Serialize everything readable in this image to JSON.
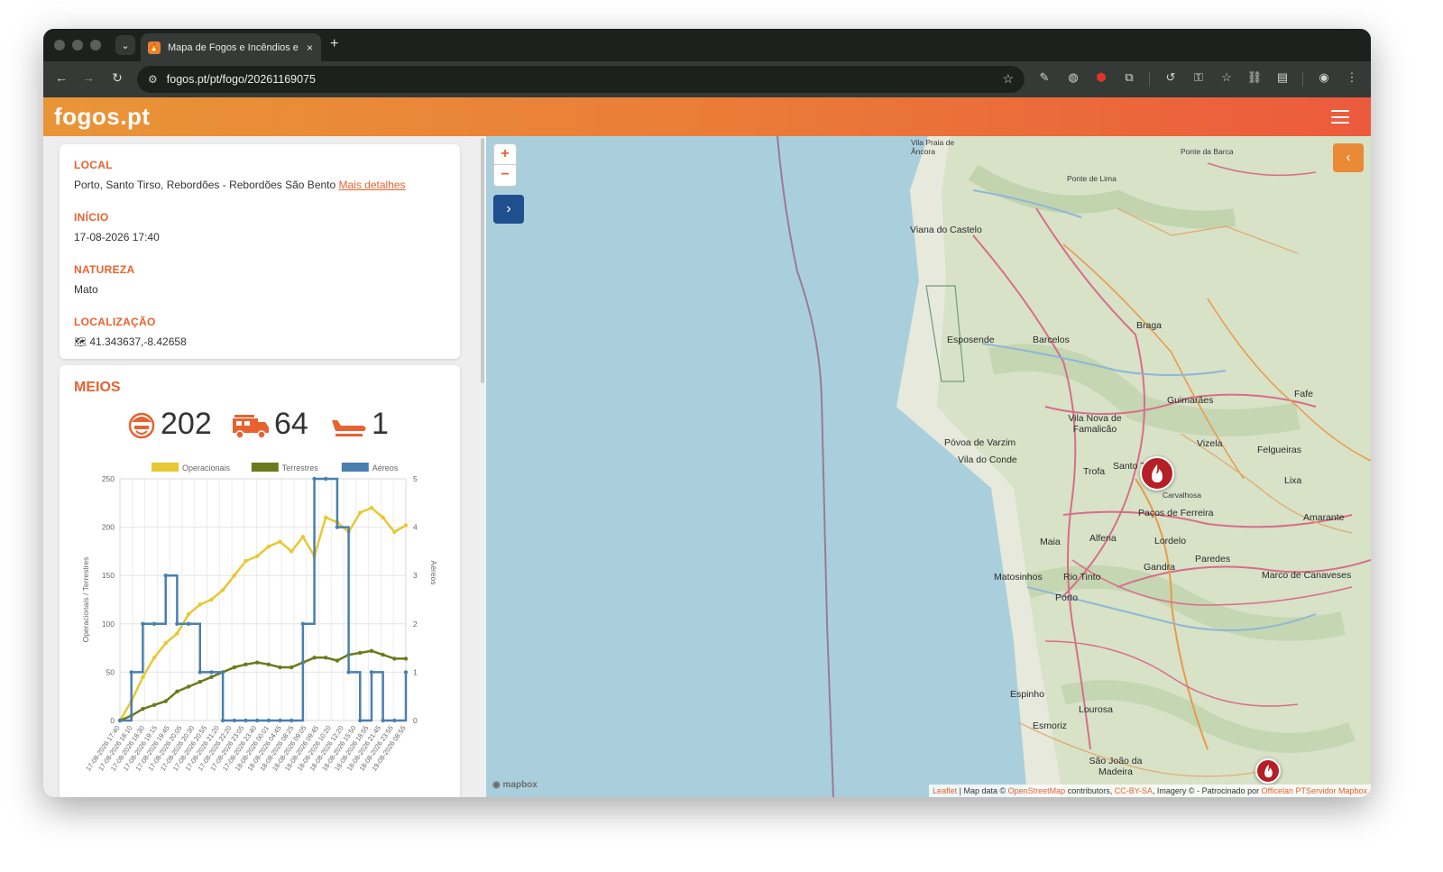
{
  "browser": {
    "tab_title": "Mapa de Fogos e Incêndios e",
    "tab_close": "×",
    "new_tab": "+",
    "url": "fogos.pt/pt/fogo/20261169075"
  },
  "site": {
    "logo": "fogos.pt"
  },
  "details": {
    "local_label": "LOCAL",
    "local_value": "Porto, Santo Tirso, Rebordões - Rebordões São Bento",
    "local_link": "Mais detalhes",
    "inicio_label": "INÍCIO",
    "inicio_value": "17-08-2026 17:40",
    "natureza_label": "NATUREZA",
    "natureza_value": "Mato",
    "localizacao_label": "LOCALIZAÇÃO",
    "localizacao_value": "41.343637,-8.42658"
  },
  "meios": {
    "title": "MEIOS",
    "operacionais": "202",
    "terrestres": "64",
    "aereos": "1"
  },
  "chart_data": {
    "type": "line",
    "legend_position": "top",
    "series": [
      {
        "name": "Operacionais",
        "color": "#e8c832",
        "axis": "left",
        "values": [
          0,
          20,
          45,
          65,
          80,
          90,
          110,
          120,
          125,
          135,
          150,
          165,
          170,
          180,
          185,
          175,
          190,
          170,
          210,
          205,
          195,
          215,
          220,
          210,
          195,
          202
        ]
      },
      {
        "name": "Terrestres",
        "color": "#6b7a1c",
        "axis": "left",
        "values": [
          0,
          5,
          12,
          16,
          20,
          30,
          35,
          40,
          45,
          50,
          55,
          58,
          60,
          58,
          55,
          55,
          60,
          65,
          65,
          62,
          68,
          70,
          72,
          68,
          64,
          64
        ]
      },
      {
        "name": "Aéreos",
        "color": "#4a7fb0",
        "axis": "right",
        "values": [
          0,
          1,
          2,
          2,
          3,
          2,
          2,
          1,
          1,
          0,
          0,
          0,
          0,
          0,
          0,
          0,
          2,
          5,
          5,
          4,
          1,
          0,
          1,
          0,
          0,
          1
        ]
      }
    ],
    "categories": [
      "17-08-2026 17:40",
      "17-08-2026 18:10",
      "17-08-2026 18:30",
      "17-08-2026 19:15",
      "17-08-2026 19:45",
      "17-08-2026 20:05",
      "17-08-2026 20:30",
      "17-08-2026 20:55",
      "17-08-2026 21:20",
      "17-08-2026 22:20",
      "17-08-2026 23:05",
      "17-08-2026 23:40",
      "18-08-2026 00:01",
      "18-08-2026 04:45",
      "18-08-2026 08:25",
      "18-08-2026 09:05",
      "18-08-2026 09:45",
      "18-08-2026 10:20",
      "18-08-2026 12:20",
      "18-08-2026 15:50",
      "18-08-2026 18:55",
      "18-08-2026 21:45",
      "18-08-2026 23:55",
      "19-08-2026 08:55"
    ],
    "ylabel_left": "Operacionais / Terrestres",
    "ylabel_right": "Aéreos",
    "ylim_left": [
      0,
      250
    ],
    "ylim_right": [
      0,
      5
    ],
    "yticks_left": [
      "0",
      "50",
      "100",
      "150",
      "200",
      "250"
    ],
    "yticks_right": [
      "0",
      "1",
      "2",
      "3",
      "4",
      "5"
    ]
  },
  "map": {
    "zoom_in": "+",
    "zoom_out": "−",
    "expand": "›",
    "collapse": "‹",
    "mapbox": "mapbox",
    "attribution_leaflet": "Leaflet",
    "attribution_text1": " | Map data © ",
    "attribution_osm": "OpenStreetMap",
    "attribution_text2": " contributors, ",
    "attribution_cc": "CC-BY-SA",
    "attribution_text3": ", Imagery © - Patrocinado por ",
    "attribution_sponsor": "Officelan PTServidor Mapbox",
    "towns": {
      "viana": "Viana do Castelo",
      "esposende": "Esposende",
      "barcelos": "Barcelos",
      "braga": "Braga",
      "guimaraes": "Guimarães",
      "famalicao": "Vila Nova de Famalicão",
      "povoa": "Póvoa de Varzim",
      "vilaconde": "Vila do Conde",
      "trofa": "Trofa",
      "santotirso": "Santo Tirso",
      "pacos": "Paços de Ferreira",
      "felgueiras": "Felgueiras",
      "vizela": "Vizela",
      "lixa": "Lixa",
      "amarante": "Amarante",
      "maia": "Maia",
      "alfena": "Alfena",
      "lordelo": "Lordelo",
      "paredes": "Paredes",
      "gandra": "Gandra",
      "matosinhos": "Matosinhos",
      "riotinto": "Rio Tinto",
      "porto": "Porto",
      "marco": "Marco de Canaveses",
      "espinho": "Espinho",
      "lourosa": "Lourosa",
      "esmoriz": "Esmoriz",
      "saojoao": "São João da Madeira",
      "fafe": "Fafe",
      "pontelima": "Ponte de Lima",
      "pontebarca": "Ponte da Barca",
      "vilapraia": "Vila Praia de Âncora",
      "carvalhosa": "Carvalhosa"
    }
  }
}
